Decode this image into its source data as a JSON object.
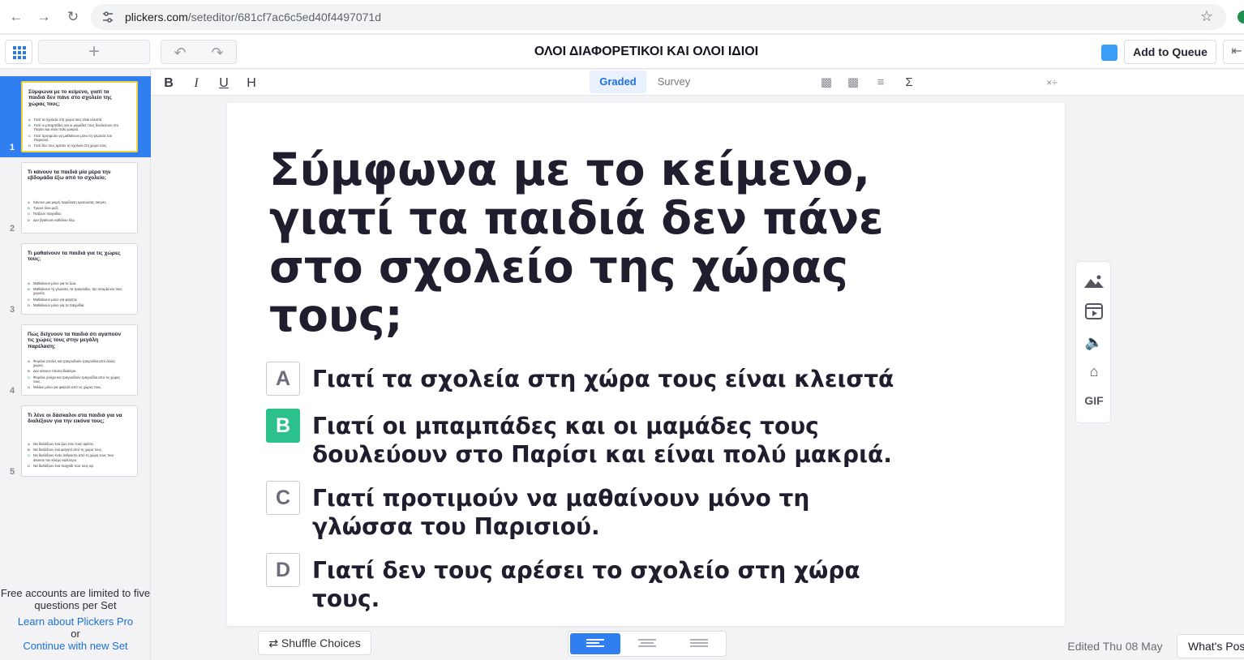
{
  "browser": {
    "url_host": "plickers.com",
    "url_path": "/seteditor/681cf7ac6c5ed40f4497071d"
  },
  "topbar": {
    "set_title": "ΟΛΟΙ ΔΙΑΦΟΡΕΤΙΚΟΙ ΚΑΙ ΟΛΟΙ ΙΔΙΟΙ",
    "add_to_queue": "Add to Queue",
    "accent_color": "#3b9df5"
  },
  "toolbar": {
    "bold": "B",
    "italic": "I",
    "underline": "U",
    "heading": "H",
    "mode_graded": "Graded",
    "mode_survey": "Survey",
    "sigma": "Σ"
  },
  "slides": [
    {
      "num": "1",
      "question": "Σύμφωνα με το κείμενο, γιατί τα παιδιά δεν πάνε στο σχολείο της χώρας τους;",
      "choices": [
        {
          "letter": "A",
          "text": "Γιατί τα σχολεία στη χώρα τους είναι κλειστά"
        },
        {
          "letter": "B",
          "text": "Γιατί οι μπαμπάδες και οι μαμάδες τους δουλεύουν στο Παρίσι και είναι πολύ μακριά."
        },
        {
          "letter": "C",
          "text": "Γιατί προτιμούν να μαθαίνουν μόνο τη γλώσσα του Παρισιού."
        },
        {
          "letter": "D",
          "text": "Γιατί δεν τους αρέσει το σχολείο στη χώρα τους."
        }
      ]
    },
    {
      "num": "2",
      "question": "Τι κάνουν τα παιδιά μία μέρα την εβδομάδα έξω από το σχολείο;",
      "choices": [
        {
          "letter": "A",
          "text": "Κάνουν μια μικρή παρέλαση κρατώντας σκηνές."
        },
        {
          "letter": "B",
          "text": "Τρώνε όλοι μαζί."
        },
        {
          "letter": "C",
          "text": "Παίζουν παιχνίδια."
        },
        {
          "letter": "D",
          "text": "Δεν βγαίνουν καθόλου έξω."
        }
      ]
    },
    {
      "num": "3",
      "question": "Τι μαθαίνουν τα παιδιά για τις χώρες τους;",
      "choices": [
        {
          "letter": "A",
          "text": "Μαθαίνουν μόνο για τα ζώα."
        },
        {
          "letter": "B",
          "text": "Μαθαίνουν τη γλώσσα, τα τραγούδια, την ιστορία και τους χορούς."
        },
        {
          "letter": "C",
          "text": "Μαθαίνουν μόνο για φαγητά."
        },
        {
          "letter": "D",
          "text": "Μαθαίνουν μόνο για τα παιχνίδια."
        }
      ]
    },
    {
      "num": "4",
      "question": "Πώς δείχνουν τα παιδιά ότι αγαπούν τις χώρες τους στην μεγάλη παρέλαση;",
      "choices": [
        {
          "letter": "A",
          "text": "Φοράνε στολές και τραγουδούν τραγούδια από άλλες χώρες."
        },
        {
          "letter": "B",
          "text": "Δεν κάνουν τίποτα ιδιαίτερο."
        },
        {
          "letter": "C",
          "text": "Φοράνε ρούχα και τραγουδούν τραγούδια από τις χώρες τους."
        },
        {
          "letter": "D",
          "text": "Μιλάνε μόνο για φαγητά από τις χώρες τους."
        }
      ]
    },
    {
      "num": "5",
      "question": "Τι λένε οι δάσκαλοι στα παιδιά για να διαλέξουν για την εικόνα τους;",
      "choices": [
        {
          "letter": "A",
          "text": "Να διαλέξουν ένα ζώο που τους αρέσει."
        },
        {
          "letter": "B",
          "text": "Να διαλέξουν ένα φαγητό από τη χώρα τους."
        },
        {
          "letter": "C",
          "text": "Να διαλέξουν έναν άνθρωπο από τη χώρα τους που άκουσε τον κόσμο καλύτερο."
        },
        {
          "letter": "D",
          "text": "Να διαλέξουν ένα παιχνίδι που τους αρ."
        }
      ]
    }
  ],
  "sidebar_note": {
    "limit_text": "Free accounts are limited to five questions per Set",
    "learn_link": "Learn about Plickers Pro",
    "or": "or",
    "continue_link": "Continue with new Set"
  },
  "editor": {
    "question": "Σύμφωνα με το κείμενο, γιατί τα παιδιά δεν πάνε στο σχολείο της χώρας τους;",
    "choices": [
      {
        "letter": "A",
        "text": "Γιατί τα σχολεία στη χώρα τους είναι κλειστά",
        "correct": false
      },
      {
        "letter": "B",
        "text": "Γιατί οι μπαμπάδες και οι μαμάδες τους δουλεύουν στο Παρίσι και είναι πολύ μακριά.",
        "correct": true
      },
      {
        "letter": "C",
        "text": " Γιατί προτιμούν να μαθαίνουν μόνο τη γλώσσα του Παρισιού.",
        "correct": false
      },
      {
        "letter": "D",
        "text": " Γιατί δεν τους αρέσει το σχολείο στη χώρα τους.",
        "correct": false
      }
    ],
    "correct_color": "#2bc08c"
  },
  "media_bar": {
    "gif": "GIF"
  },
  "bottom": {
    "shuffle": "Shuffle Choices",
    "edited": "Edited Thu 08 May",
    "whats_new": "What's Pos"
  }
}
